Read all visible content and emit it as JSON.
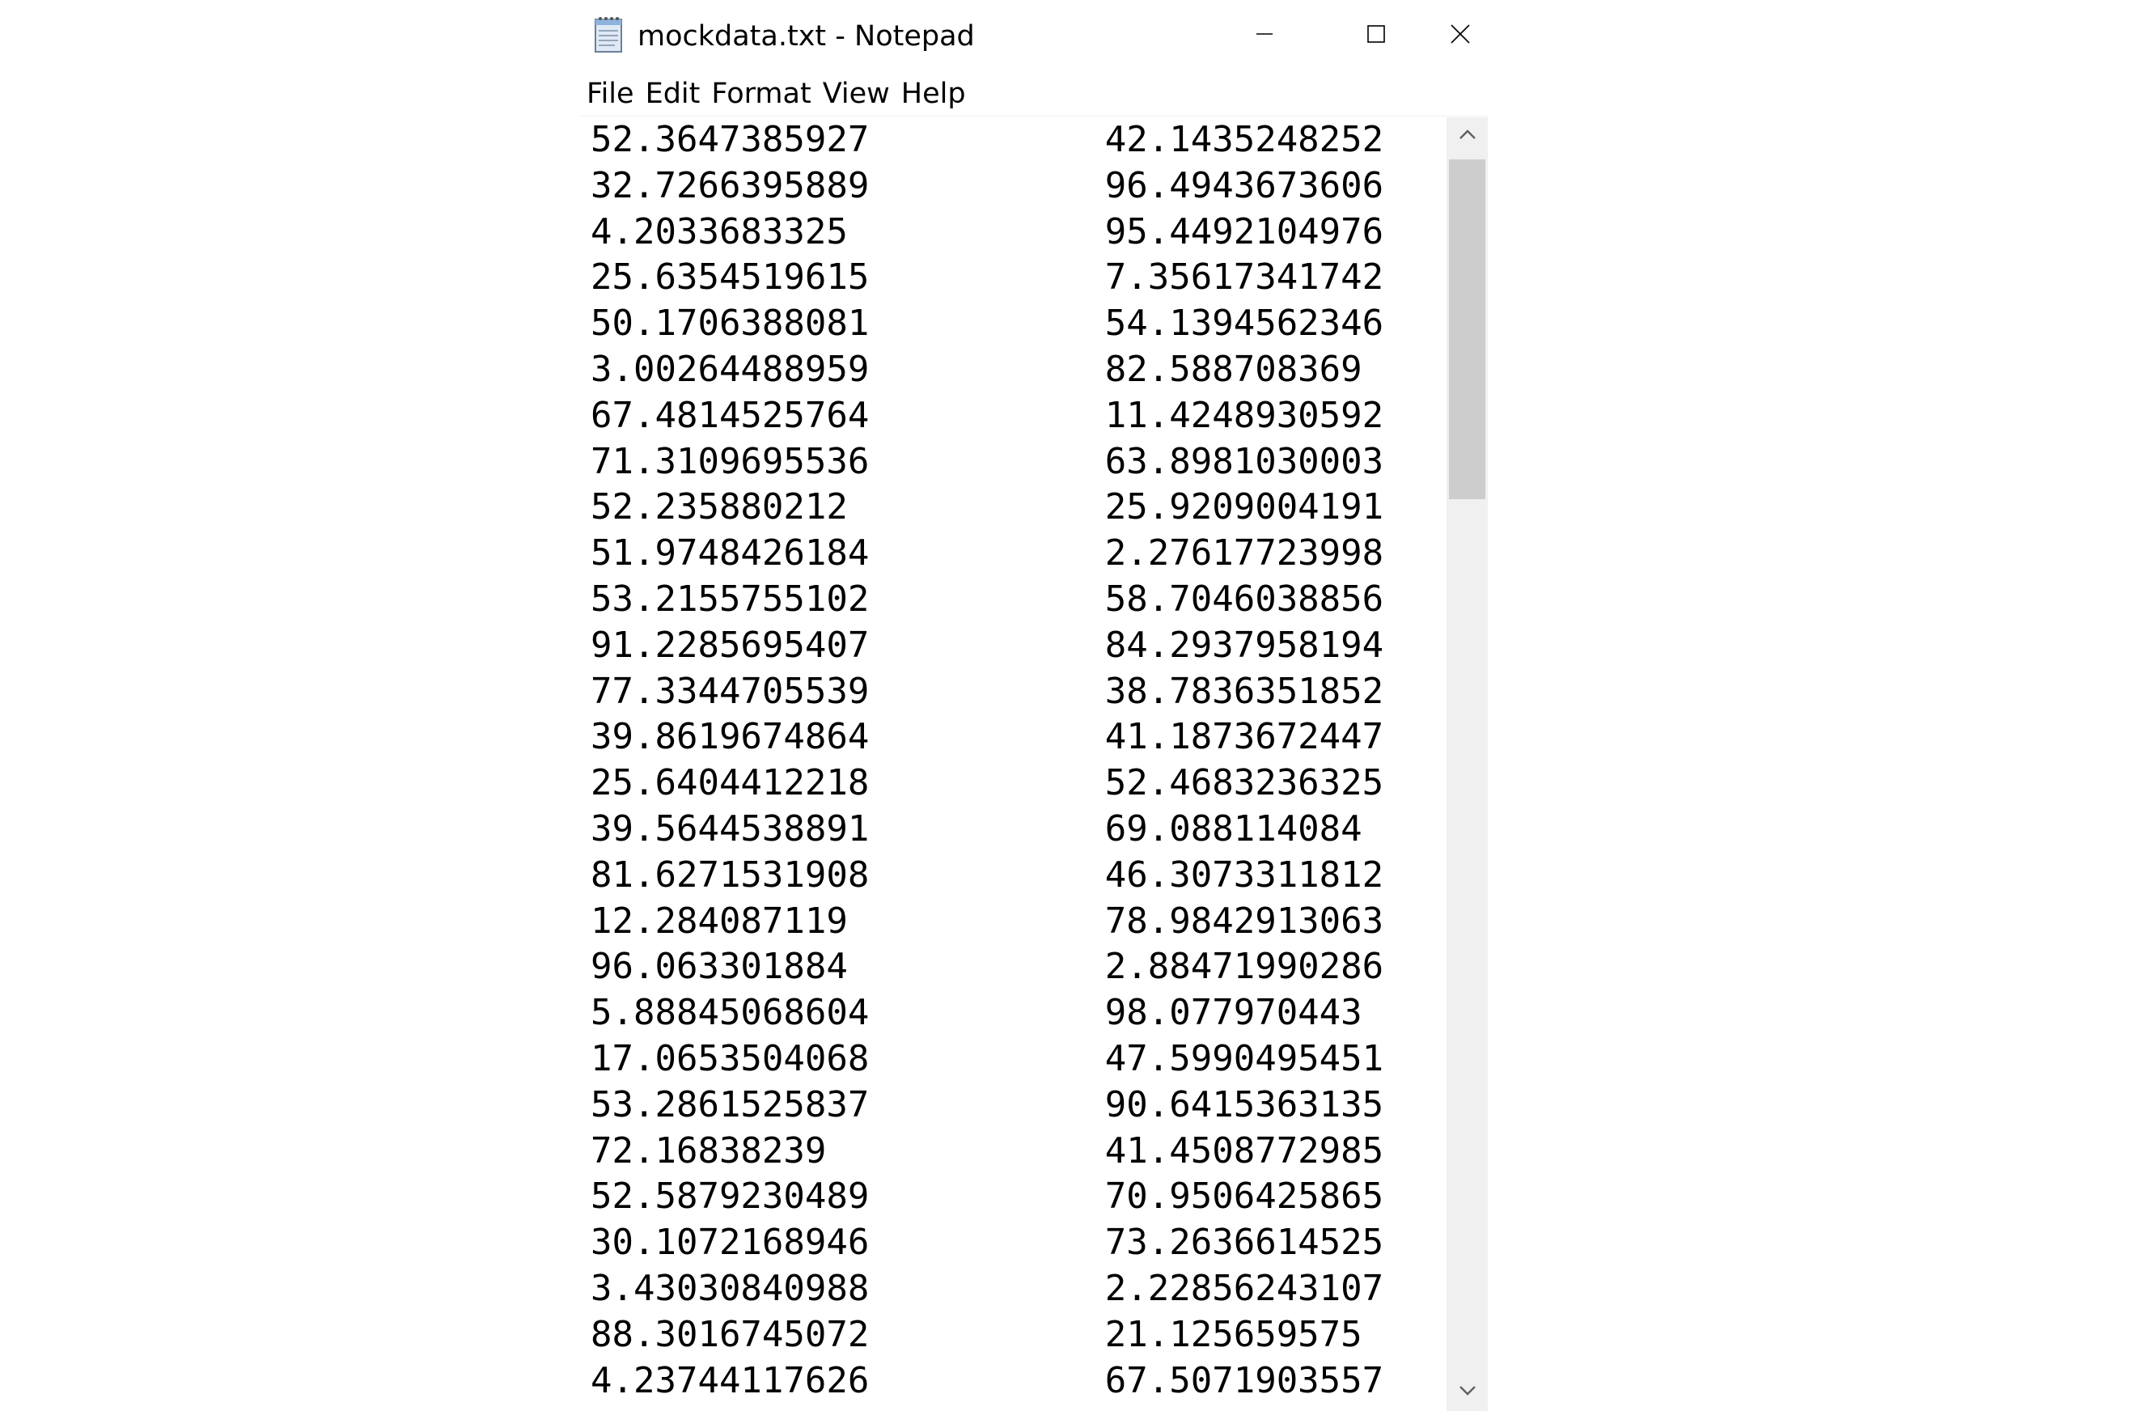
{
  "window": {
    "title": "mockdata.txt - Notepad"
  },
  "menu": [
    "File",
    "Edit",
    "Format",
    "View",
    "Help"
  ],
  "icons": {
    "app": "notepad-icon",
    "minimize": "minimize-icon",
    "maximize": "maximize-icon",
    "close": "close-icon",
    "scroll_up": "chevron-up-icon",
    "scroll_down": "chevron-down-icon"
  },
  "document": {
    "lines": [
      "52.3647385927\t\t42.1435248252",
      "32.7266395889\t\t96.4943673606",
      "4.2033683325\t\t95.4492104976",
      "25.6354519615\t\t7.35617341742",
      "50.1706388081\t\t54.1394562346",
      "3.00264488959\t\t82.588708369",
      "67.4814525764\t\t11.4248930592",
      "71.3109695536\t\t63.8981030003",
      "52.235880212\t\t25.9209004191",
      "51.9748426184\t\t2.27617723998",
      "53.2155755102\t\t58.7046038856",
      "91.2285695407\t\t84.2937958194",
      "77.3344705539\t\t38.7836351852",
      "39.8619674864\t\t41.1873672447",
      "25.6404412218\t\t52.4683236325",
      "39.5644538891\t\t69.088114084",
      "81.6271531908\t\t46.3073311812",
      "12.284087119\t\t78.9842913063",
      "96.063301884\t\t2.88471990286",
      "5.88845068604\t\t98.077970443",
      "17.0653504068\t\t47.5990495451",
      "53.2861525837\t\t90.6415363135",
      "72.16838239\t\t41.4508772985",
      "52.5879230489\t\t70.9506425865",
      "30.1072168946\t\t73.2636614525",
      "3.43030840988\t\t2.22856243107",
      "88.3016745072\t\t21.125659575",
      "4.23744117626\t\t67.5071903557"
    ]
  }
}
